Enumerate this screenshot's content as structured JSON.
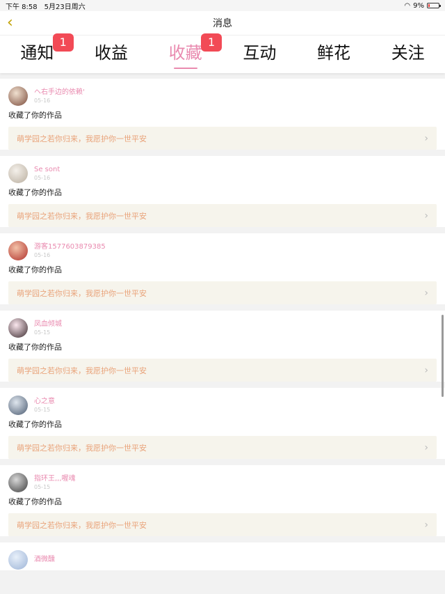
{
  "status": {
    "time": "下午 8:58",
    "date": "5月23日周六",
    "battery": "9%"
  },
  "nav": {
    "title": "消息",
    "back_icon": "chevron-left-icon"
  },
  "tabs": [
    {
      "label": "通知",
      "badge": "1"
    },
    {
      "label": "收益",
      "badge": ""
    },
    {
      "label": "收藏",
      "badge": "1",
      "active": true
    },
    {
      "label": "互动",
      "badge": ""
    },
    {
      "label": "鲜花",
      "badge": ""
    },
    {
      "label": "关注",
      "badge": ""
    }
  ],
  "items": [
    {
      "user": "ヘ右手边的依赖'",
      "date": "05-16",
      "action": "收藏了你的作品",
      "work": "萌学园之若你归来，我愿护你一世平安"
    },
    {
      "user": "Se sont",
      "date": "05-16",
      "action": "收藏了你的作品",
      "work": "萌学园之若你归来，我愿护你一世平安"
    },
    {
      "user": "游客1577603879385",
      "date": "05-16",
      "action": "收藏了你的作品",
      "work": "萌学园之若你归来，我愿护你一世平安"
    },
    {
      "user": "凤血倾城",
      "date": "05-15",
      "action": "收藏了你的作品",
      "work": "萌学园之若你归来，我愿护你一世平安"
    },
    {
      "user": "心之意",
      "date": "05-15",
      "action": "收藏了你的作品",
      "work": "萌学园之若你归来，我愿护你一世平安"
    },
    {
      "user": "指环王,,,喔魂",
      "date": "05-15",
      "action": "收藏了你的作品",
      "work": "萌学园之若你归来，我愿护你一世平安"
    }
  ],
  "partial_item": {
    "user": "酒微醺"
  },
  "colors": {
    "accent": "#e98aaf",
    "badge": "#f24a56",
    "work_title": "#e9a37a",
    "work_bg": "#f6f4ec"
  }
}
